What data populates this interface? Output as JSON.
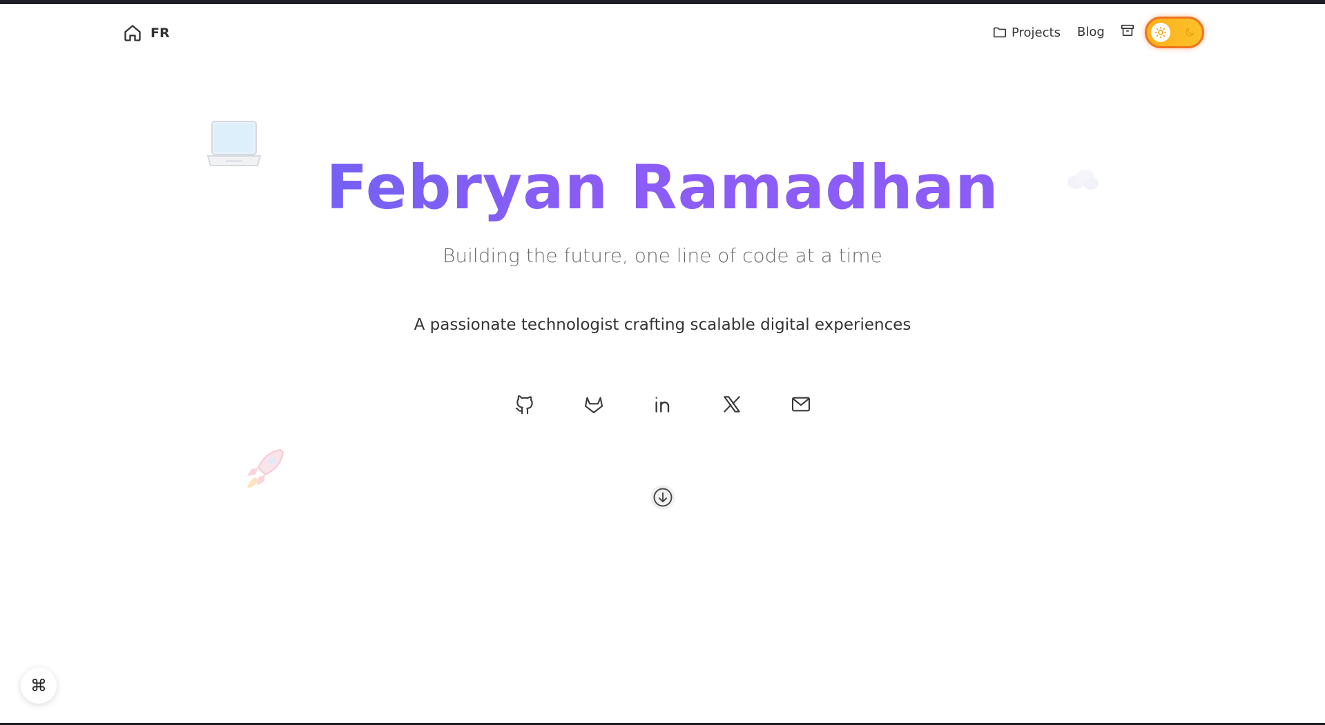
{
  "header": {
    "brand_text": "FR",
    "nav": {
      "projects_label": "Projects",
      "blog_label": "Blog"
    },
    "theme_toggle": {
      "mode": "light",
      "accent": "#fbb21b",
      "border": "#f0731e"
    }
  },
  "hero": {
    "name": "Febryan Ramadhan",
    "tagline": "Building the future, one line of code at a time",
    "description": "A passionate technologist crafting scalable digital experiences",
    "gradient": [
      "#5a67f1",
      "#8b5cf6"
    ]
  },
  "socials": [
    {
      "icon": "github-icon"
    },
    {
      "icon": "gitlab-icon"
    },
    {
      "icon": "linkedin-icon"
    },
    {
      "icon": "x-twitter-icon"
    },
    {
      "icon": "mail-icon"
    }
  ],
  "command_button": {
    "glyph": "⌘"
  }
}
